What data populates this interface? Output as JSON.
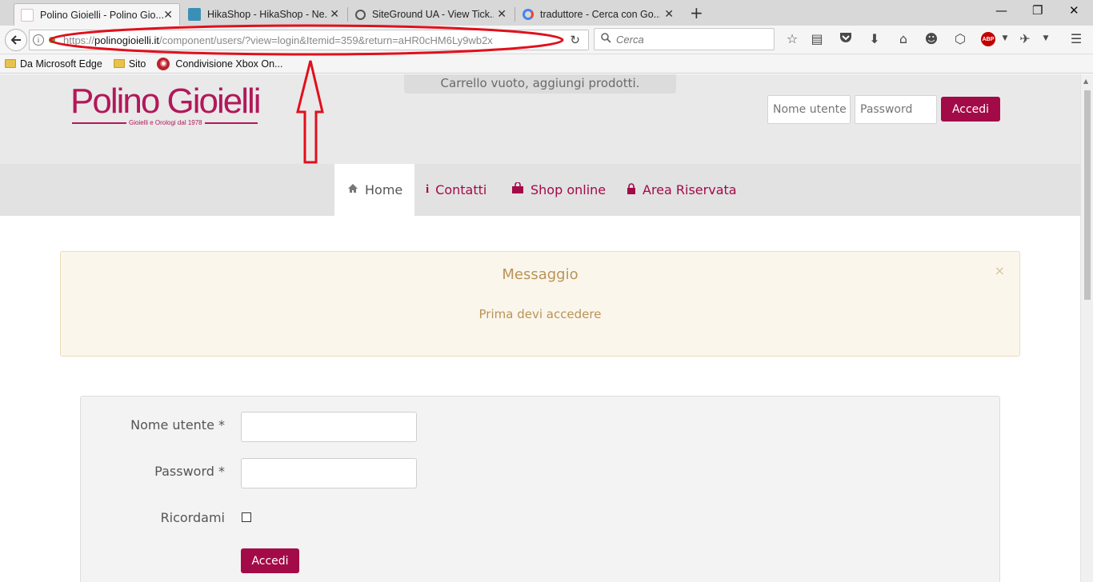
{
  "browser": {
    "tabs": [
      {
        "title": "Polino Gioielli - Polino Gio...",
        "active": true
      },
      {
        "title": "HikaShop - HikaShop - Ne...",
        "active": false
      },
      {
        "title": "SiteGround UA - View Tick...",
        "active": false
      },
      {
        "title": "traduttore - Cerca con Go...",
        "active": false
      }
    ],
    "tab_close_glyph": "✕",
    "new_tab_glyph": "+",
    "window_controls": {
      "minimize": "—",
      "restore": "❐",
      "close": "✕"
    },
    "url": {
      "prefix": "https://",
      "domain": "polinogioielli.it",
      "path": "/component/users/?view=login&Itemid=359&return=aHR0cHM6Ly9wb2x"
    },
    "search_placeholder": "Cerca",
    "bookmarks": [
      "Da Microsoft Edge",
      "Sito",
      "Condivisione Xbox On..."
    ],
    "toolbar_icons": [
      "star-icon",
      "reading-list-icon",
      "pocket-icon",
      "download-icon",
      "home-icon",
      "chat-icon",
      "extension-icon",
      "adblock-icon",
      "extension-2-icon",
      "menu-icon"
    ],
    "abp_label": "ABP"
  },
  "site": {
    "logo_text": "Polino Gioielli",
    "logo_tagline": "Gioielli e Orologi dal 1978",
    "cart_text": "Carrello vuoto, aggiungi prodotti.",
    "header_login": {
      "username_placeholder": "Nome utente",
      "password_placeholder": "Password",
      "button": "Accedi"
    },
    "menu": [
      {
        "label": "Home",
        "icon": "home-icon",
        "active": true
      },
      {
        "label": "Contatti",
        "icon": "info-icon",
        "active": false
      },
      {
        "label": "Shop online",
        "icon": "shopping-bag-icon",
        "active": false
      },
      {
        "label": "Area Riservata",
        "icon": "lock-icon",
        "active": false
      }
    ],
    "message": {
      "title": "Messaggio",
      "text": "Prima devi accedere",
      "close": "×"
    },
    "login_form": {
      "username_label": "Nome utente *",
      "password_label": "Password *",
      "remember_label": "Ricordami",
      "submit": "Accedi"
    }
  },
  "colors": {
    "brand": "#a30a48",
    "annotation": "#e0101c",
    "message_text": "#b89458",
    "message_bg": "#fbf6ec"
  }
}
